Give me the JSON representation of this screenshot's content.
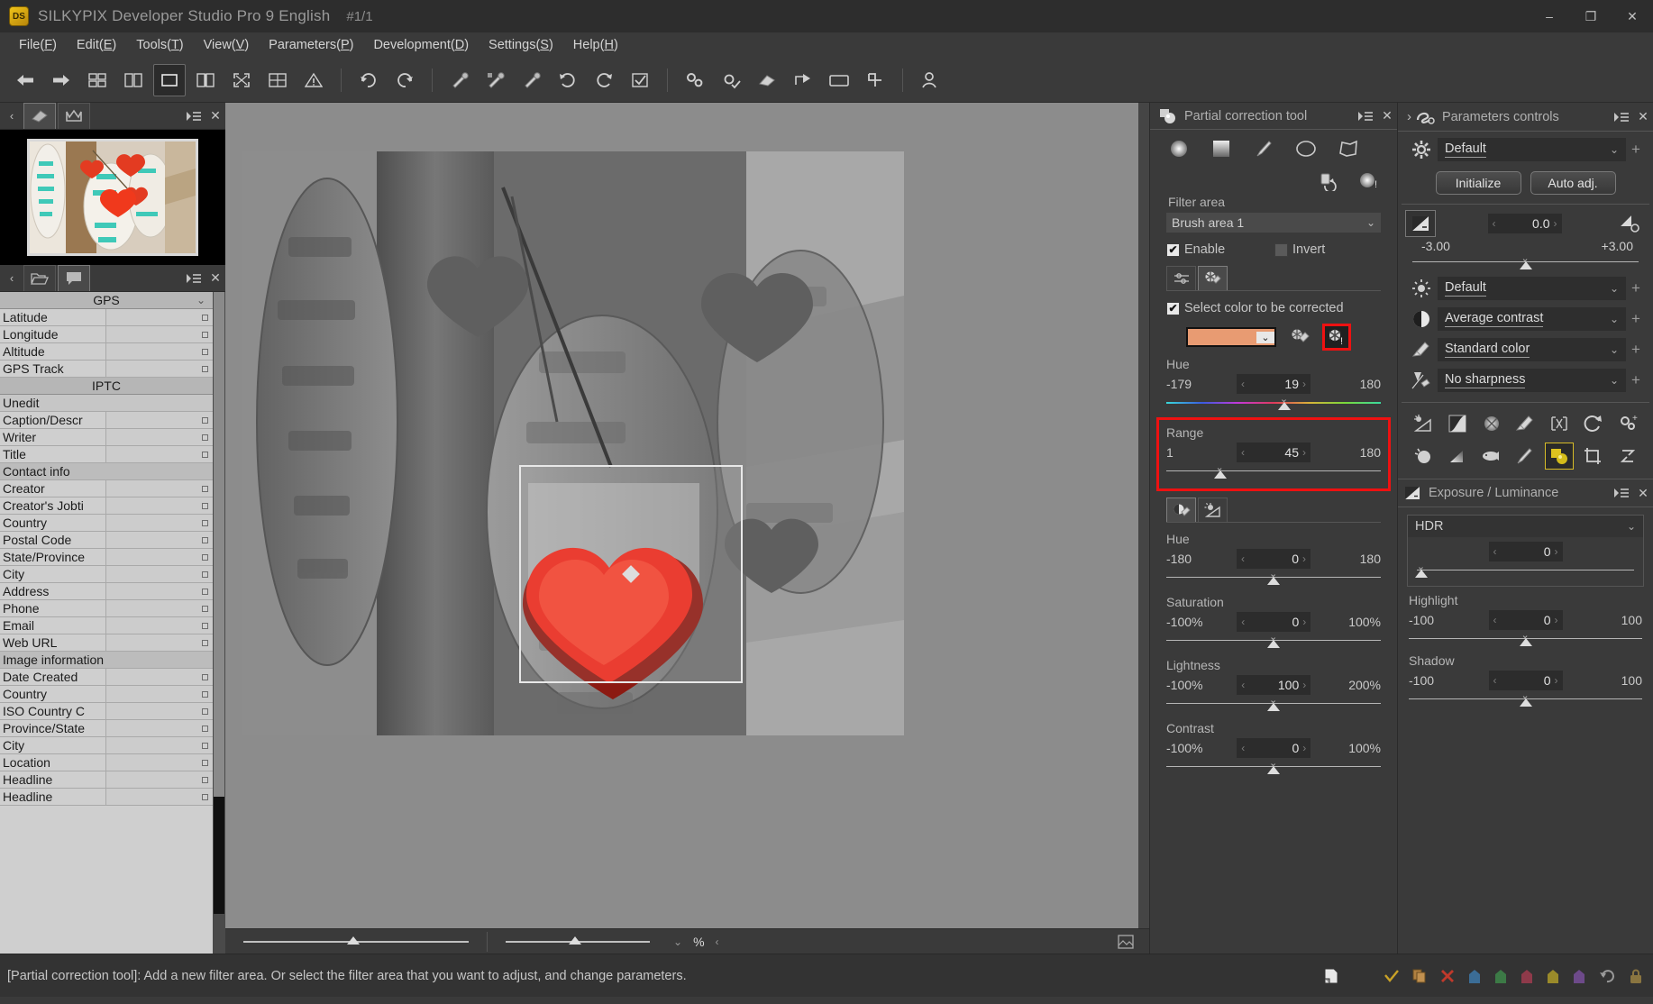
{
  "window": {
    "logo_text": "DS",
    "title": "SILKYPIX Developer Studio Pro 9 English",
    "index": "#1/1",
    "minimize": "–",
    "maximize": "❐",
    "close": "✕"
  },
  "menubar": [
    {
      "label": "File",
      "key": "F"
    },
    {
      "label": "Edit",
      "key": "E"
    },
    {
      "label": "Tools",
      "key": "T"
    },
    {
      "label": "View",
      "key": "V"
    },
    {
      "label": "Parameters",
      "key": "P"
    },
    {
      "label": "Development",
      "key": "D"
    },
    {
      "label": "Settings",
      "key": "S"
    },
    {
      "label": "Help",
      "key": "H"
    }
  ],
  "toolbar": {
    "items": [
      "back-arrow-icon",
      "forward-arrow-icon",
      "grid-view-icon",
      "split-view-icon",
      "single-view-icon",
      "compare-view-icon",
      "fullscreen-icon",
      "multi-view-icon",
      "warning-icon",
      "undo-icon",
      "redo-icon",
      "color-picker-1-icon",
      "color-picker-2-icon",
      "color-picker-3-icon",
      "rotate-left-icon",
      "rotate-right-icon",
      "checkmark-box-icon",
      "batch-settings-icon",
      "develop-check-icon",
      "eraser-icon",
      "export-icon",
      "monitor-icon",
      "crop-tool-icon",
      "person-icon"
    ]
  },
  "left_panel": {
    "tabs_top": [
      "thumbnail-tab-icon",
      "crown-tab-icon"
    ],
    "tabs_bottom": [
      "folder-tab-icon",
      "metadata-tab-icon"
    ],
    "menu_icon": "panel-menu-icon",
    "close_icon": "panel-close-icon",
    "collapse_icon": "‹",
    "metadata": {
      "sections": [
        {
          "title": "GPS",
          "rows": [
            {
              "key": "Latitude",
              "value": "",
              "type": "field"
            },
            {
              "key": "Longitude",
              "value": "",
              "type": "field"
            },
            {
              "key": "Altitude",
              "value": "",
              "type": "field"
            },
            {
              "key": "GPS Track",
              "value": "",
              "type": "field"
            }
          ]
        },
        {
          "title": "IPTC",
          "rows": [
            {
              "key": "Unedit",
              "value": "",
              "type": "combo"
            },
            {
              "key": "Caption/Descr",
              "value": "",
              "type": "field"
            },
            {
              "key": "Writer",
              "value": "",
              "type": "field"
            },
            {
              "key": "Title",
              "value": "",
              "type": "field"
            },
            {
              "key": "Contact info",
              "value": "",
              "type": "group"
            },
            {
              "key": "Creator",
              "value": "",
              "type": "field"
            },
            {
              "key": "Creator's Jobti",
              "value": "",
              "type": "field"
            },
            {
              "key": "Country",
              "value": "",
              "type": "field"
            },
            {
              "key": "Postal Code",
              "value": "",
              "type": "field"
            },
            {
              "key": "State/Province",
              "value": "",
              "type": "field"
            },
            {
              "key": "City",
              "value": "",
              "type": "field"
            },
            {
              "key": "Address",
              "value": "",
              "type": "field"
            },
            {
              "key": "Phone",
              "value": "",
              "type": "field"
            },
            {
              "key": "Email",
              "value": "",
              "type": "field"
            },
            {
              "key": "Web URL",
              "value": "",
              "type": "field"
            },
            {
              "key": "Image information",
              "value": "",
              "type": "group"
            },
            {
              "key": "Date Created",
              "value": "",
              "type": "field"
            },
            {
              "key": "Country",
              "value": "",
              "type": "field"
            },
            {
              "key": "ISO Country C",
              "value": "",
              "type": "field"
            },
            {
              "key": "Province/State",
              "value": "",
              "type": "field"
            },
            {
              "key": "City",
              "value": "",
              "type": "field"
            },
            {
              "key": "Location",
              "value": "",
              "type": "field"
            },
            {
              "key": "Headline",
              "value": "",
              "type": "field"
            },
            {
              "key": "Headline",
              "value": "",
              "type": "field"
            }
          ]
        }
      ]
    }
  },
  "viewer": {
    "zoom_percent_symbol": "%",
    "zoom_value": "",
    "left_arrow": "‹",
    "right_arrow": "›"
  },
  "partial_correction": {
    "header_title": "Partial correction tool",
    "header_icon": "partial-correction-icon",
    "menu_icon": "panel-menu-icon",
    "close_icon": "panel-close-icon",
    "tools": [
      "circular-gradient-icon",
      "linear-gradient-icon",
      "brush-icon",
      "ellipse-icon",
      "polygon-icon"
    ],
    "action_icons": [
      "reset-brush-icon",
      "new-area-icon"
    ],
    "filter_area_label": "Filter area",
    "filter_area_value": "Brush area 1",
    "enable_label": "Enable",
    "enable_checked": true,
    "invert_label": "Invert",
    "invert_checked": false,
    "subtabs": [
      "sliders-tab-icon",
      "color-picker-tab-icon"
    ],
    "select_color_label": "Select color to be corrected",
    "select_color_checked": true,
    "swatch_color": "#e89b72",
    "picker_icons": [
      "eyedropper-icon",
      "color-range-icon"
    ],
    "sliders_top": [
      {
        "name": "Hue",
        "min": "-179",
        "value": "19",
        "max": "180",
        "knob_pct": 55,
        "gradient": true
      },
      {
        "name": "Range",
        "min": "1",
        "value": "45",
        "max": "180",
        "knob_pct": 25,
        "gradient": false,
        "highlighted": true
      }
    ],
    "mode_tabs": [
      "contrast-picker-icon",
      "exposure-tool-icon"
    ],
    "sliders_bottom": [
      {
        "name": "Hue",
        "min": "-180",
        "value": "0",
        "max": "180",
        "knob_pct": 50
      },
      {
        "name": "Saturation",
        "min": "-100%",
        "value": "0",
        "max": "100%",
        "knob_pct": 50
      },
      {
        "name": "Lightness",
        "min": "-100%",
        "value": "100",
        "max": "200%",
        "knob_pct": 50
      },
      {
        "name": "Contrast",
        "min": "-100%",
        "value": "0",
        "max": "100%",
        "knob_pct": 50
      }
    ]
  },
  "parameters_controls": {
    "header_title": "Parameters controls",
    "header_icon": "parameters-controls-icon",
    "expand_icon": "›",
    "menu_icon": "panel-menu-icon",
    "close_icon": "panel-close-icon",
    "taste_select": {
      "icon": "gear-icon",
      "value": "Default"
    },
    "initialize_label": "Initialize",
    "auto_adj_label": "Auto adj.",
    "exposure": {
      "icon": "exposure-bias-icon",
      "value": "0.0",
      "min": "-3.00",
      "max": "+3.00",
      "aux_icon": "exposure-settings-icon",
      "knob_pct": 50
    },
    "selects": [
      {
        "icon": "white-balance-icon",
        "value": "Default"
      },
      {
        "icon": "contrast-icon",
        "value": "Average contrast"
      },
      {
        "icon": "color-icon",
        "value": "Standard color"
      },
      {
        "icon": "sharpness-icon",
        "value": "No sharpness"
      }
    ],
    "icon_grid_row1": [
      "tone-icon",
      "tone-curve-icon",
      "noise-reduction-icon",
      "color-adjust-icon",
      "lens-aberration-icon",
      "rotate-icon",
      "misc-settings-icon"
    ],
    "icon_grid_row2": [
      "dodge-burn-icon",
      "gradient-icon",
      "fisheye-icon",
      "brush-icon",
      "partial-correction-icon",
      "crop-icon",
      "restore-icon"
    ],
    "selected_grid_icon": "partial-correction-icon"
  },
  "exposure_luminance": {
    "header_title": "Exposure / Luminance",
    "header_icon": "exposure-bias-icon",
    "menu_icon": "panel-menu-icon",
    "close_icon": "panel-close-icon",
    "hdr": {
      "label": "HDR",
      "value": "0",
      "knob_pct": 2
    },
    "sliders": [
      {
        "name": "Highlight",
        "min": "-100",
        "value": "0",
        "max": "100",
        "knob_pct": 50
      },
      {
        "name": "Shadow",
        "min": "-100",
        "value": "0",
        "max": "100",
        "knob_pct": 50
      }
    ]
  },
  "statusbar": {
    "message": "[Partial correction tool]: Add a new filter area. Or select the filter area that you want to adjust, and change parameters.",
    "icons": [
      "page-icon"
    ],
    "flags": [
      {
        "name": "check-mark-flag",
        "color": "#c9a227"
      },
      {
        "name": "copy-flag",
        "color": "#b08040"
      },
      {
        "name": "reject-flag",
        "color": "#c0392b"
      },
      {
        "name": "blue-flag",
        "color": "#3b6d96"
      },
      {
        "name": "green-flag",
        "color": "#3c7a46"
      },
      {
        "name": "red-flag",
        "color": "#8e3a4a"
      },
      {
        "name": "yellow-flag",
        "color": "#9a8a2a"
      },
      {
        "name": "purple-flag",
        "color": "#6d4a8a"
      },
      {
        "name": "undo-flag",
        "color": "#8a8a8a"
      },
      {
        "name": "lock-flag",
        "color": "#8a7540"
      }
    ]
  }
}
